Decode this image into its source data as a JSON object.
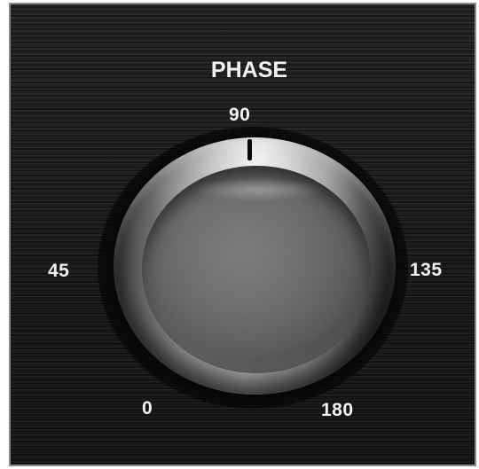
{
  "phase_control": {
    "title": "PHASE",
    "ticks": {
      "t90": "90",
      "t45": "45",
      "t135": "135",
      "t0": "0",
      "t180": "180"
    },
    "knob_pointer_at": "90"
  }
}
